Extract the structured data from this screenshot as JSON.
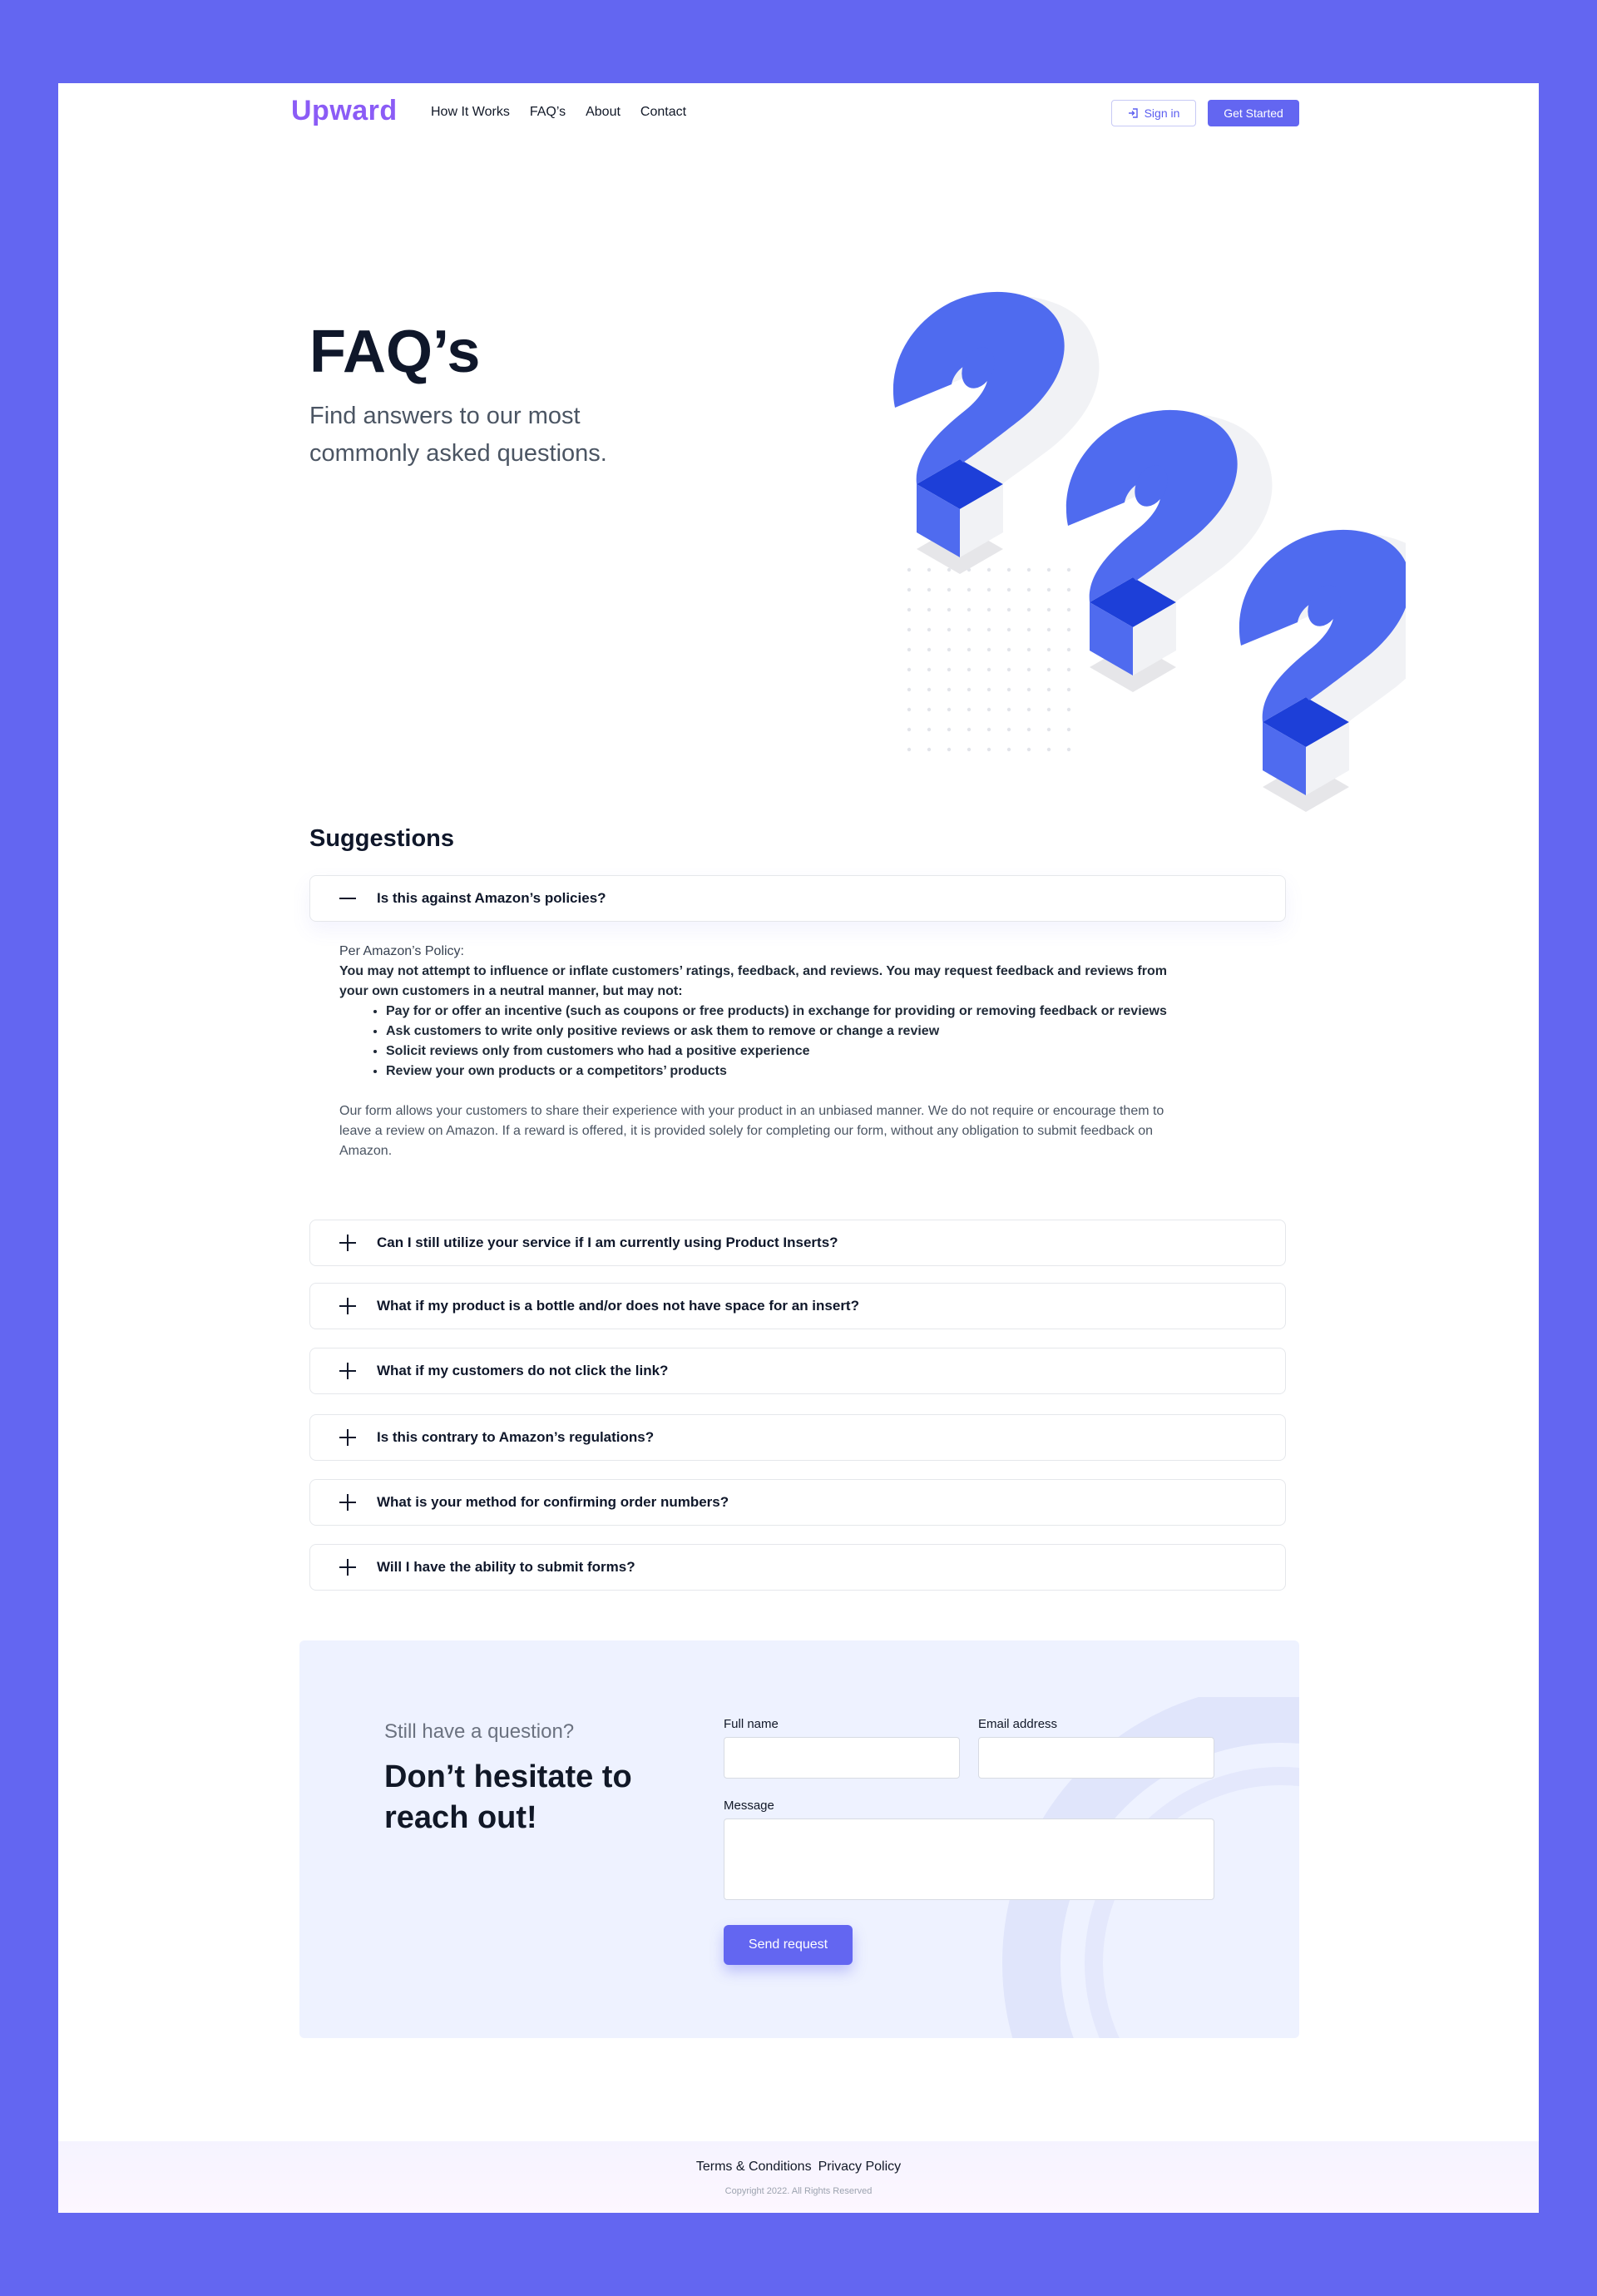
{
  "nav": {
    "logo": "Upward",
    "links": [
      "How It Works",
      "FAQ’s",
      "About",
      "Contact"
    ],
    "signin_label": "Sign in",
    "get_started_label": "Get Started"
  },
  "hero": {
    "title": "FAQ’s",
    "subtitle": "Find answers to our most commonly asked questions."
  },
  "suggestions": {
    "title": "Suggestions",
    "items": [
      {
        "question": "Is this against Amazon’s policies?",
        "expanded": true
      },
      {
        "question": "Can I still utilize your service if I am currently using Product Inserts?",
        "expanded": false
      },
      {
        "question": "What if my product is a bottle and/or does not have space for an insert?",
        "expanded": false
      },
      {
        "question": "What if my customers do not click the link?",
        "expanded": false
      },
      {
        "question": "Is this contrary to Amazon’s regulations?",
        "expanded": false
      },
      {
        "question": "What is your method for confirming order numbers?",
        "expanded": false
      },
      {
        "question": "Will I have the ability to submit forms?",
        "expanded": false
      }
    ],
    "answer": {
      "intro": "Per Amazon’s Policy:",
      "policy": "You may not attempt to influence or inflate customers’ ratings, feedback, and reviews. You may request feedback and reviews from your own customers in a neutral manner, but may not:",
      "bullets": [
        "Pay for or offer an incentive (such as coupons or free products) in exchange for providing or removing feedback or reviews",
        "Ask customers to write only positive reviews or ask them to remove or change a review",
        "Solicit reviews only from customers who had a positive experience",
        "Review your own products or a competitors’ products"
      ],
      "note": "Our form allows your customers to share their experience with your product in an unbiased manner. We do not require or encourage them to leave a review on Amazon. If a reward is offered, it is provided solely for completing our form, without any obligation to submit feedback on Amazon."
    }
  },
  "contact": {
    "kicker": "Still have a question?",
    "heading": "Don’t hesitate to reach out!",
    "full_name_label": "Full name",
    "full_name_value": "",
    "email_label": "Email address",
    "email_value": "",
    "message_label": "Message",
    "message_value": "",
    "send_label": "Send request"
  },
  "footer": {
    "terms": "Terms & Conditions",
    "privacy": "Privacy Policy",
    "copyright": "Copyright 2022. All Rights Reserved"
  },
  "colors": {
    "page_bg": "#6366F1",
    "accent": "#6366F1",
    "logo": "#8B5CF6",
    "question_mark_blue": "#4F6BEF",
    "question_mark_dark": "#1D3FD8"
  },
  "icons": [
    "sign-in-icon",
    "minus-icon",
    "plus-icon",
    "question-mark-illustration"
  ]
}
